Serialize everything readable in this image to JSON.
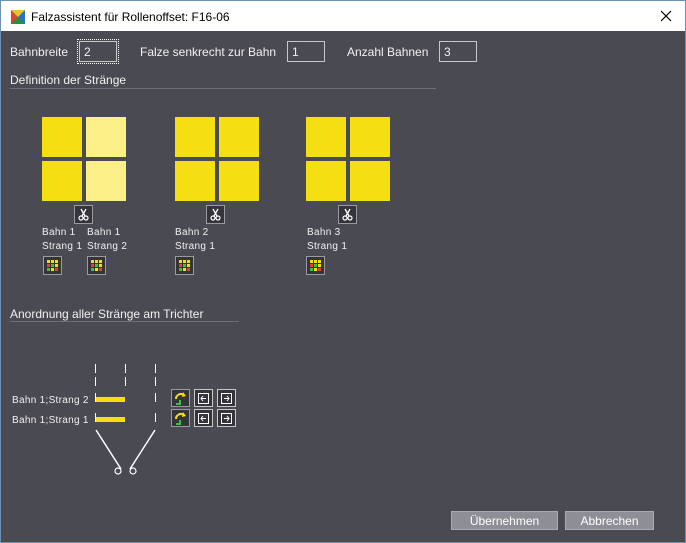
{
  "window": {
    "title": "Falzassistent für Rollenoffset: F16-06"
  },
  "settings": {
    "bahnbreite_label": "Bahnbreite",
    "bahnbreite_value": "2",
    "falze_label": "Falze senkrecht zur Bahn",
    "falze_value": "1",
    "anzahl_label": "Anzahl Bahnen",
    "anzahl_value": "3"
  },
  "definition": {
    "heading": "Definition der Stränge",
    "groups": [
      {
        "strands": [
          {
            "bahn": "Bahn 1",
            "strang": "Strang 1"
          },
          {
            "bahn": "Bahn 1",
            "strang": "Strang 2"
          }
        ]
      },
      {
        "strands": [
          {
            "bahn": "Bahn 2",
            "strang": "Strang 1"
          }
        ]
      },
      {
        "strands": [
          {
            "bahn": "Bahn 3",
            "strang": "Strang 1"
          }
        ]
      }
    ]
  },
  "arrangement": {
    "heading": "Anordnung aller Stränge am Trichter",
    "rows": [
      {
        "label": "Bahn 1;Strang 2"
      },
      {
        "label": "Bahn 1;Strang 1"
      }
    ]
  },
  "buttons": {
    "ok": "Übernehmen",
    "cancel": "Abbrechen"
  },
  "colors": {
    "background": "#4a4a52",
    "accent_yellow": "#f3df12",
    "light_yellow": "#fdef88"
  }
}
